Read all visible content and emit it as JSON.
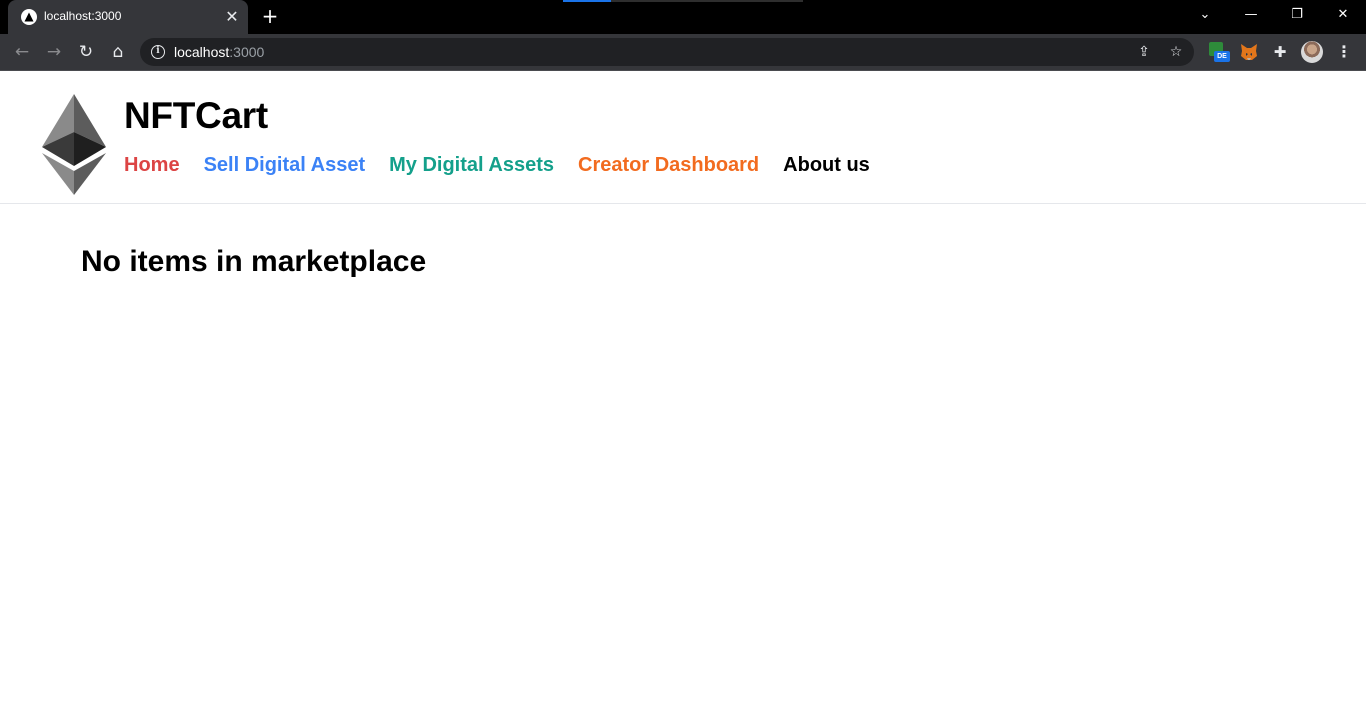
{
  "browser": {
    "tab": {
      "title": "localhost:3000",
      "close_glyph": "✕"
    },
    "new_tab_glyph": "+",
    "window_controls": {
      "tabsearch_glyph": "⌄",
      "minimize_glyph": "—",
      "restore_glyph": "❐",
      "close_glyph": "✕"
    },
    "toolbar": {
      "back_glyph": "←",
      "forward_glyph": "→",
      "reload_glyph": "↻",
      "home_glyph": "⌂",
      "url_host": "localhost",
      "url_port": ":3000",
      "share_glyph": "⇪",
      "star_glyph": "☆",
      "puzzle_glyph": "✚",
      "menu_glyph": "⋮",
      "extension_badge": "DE"
    }
  },
  "site": {
    "brand": "NFTCart",
    "nav": {
      "home": "Home",
      "sell": "Sell Digital Asset",
      "my_assets": "My Digital Assets",
      "creator": "Creator Dashboard",
      "about": "About us"
    },
    "nav_colors": {
      "home": "#dc4444",
      "sell": "#3b82f6",
      "my_assets": "#14a08b",
      "creator": "#f26b1f",
      "about": "#000000"
    },
    "empty_message": "No items in marketplace"
  }
}
